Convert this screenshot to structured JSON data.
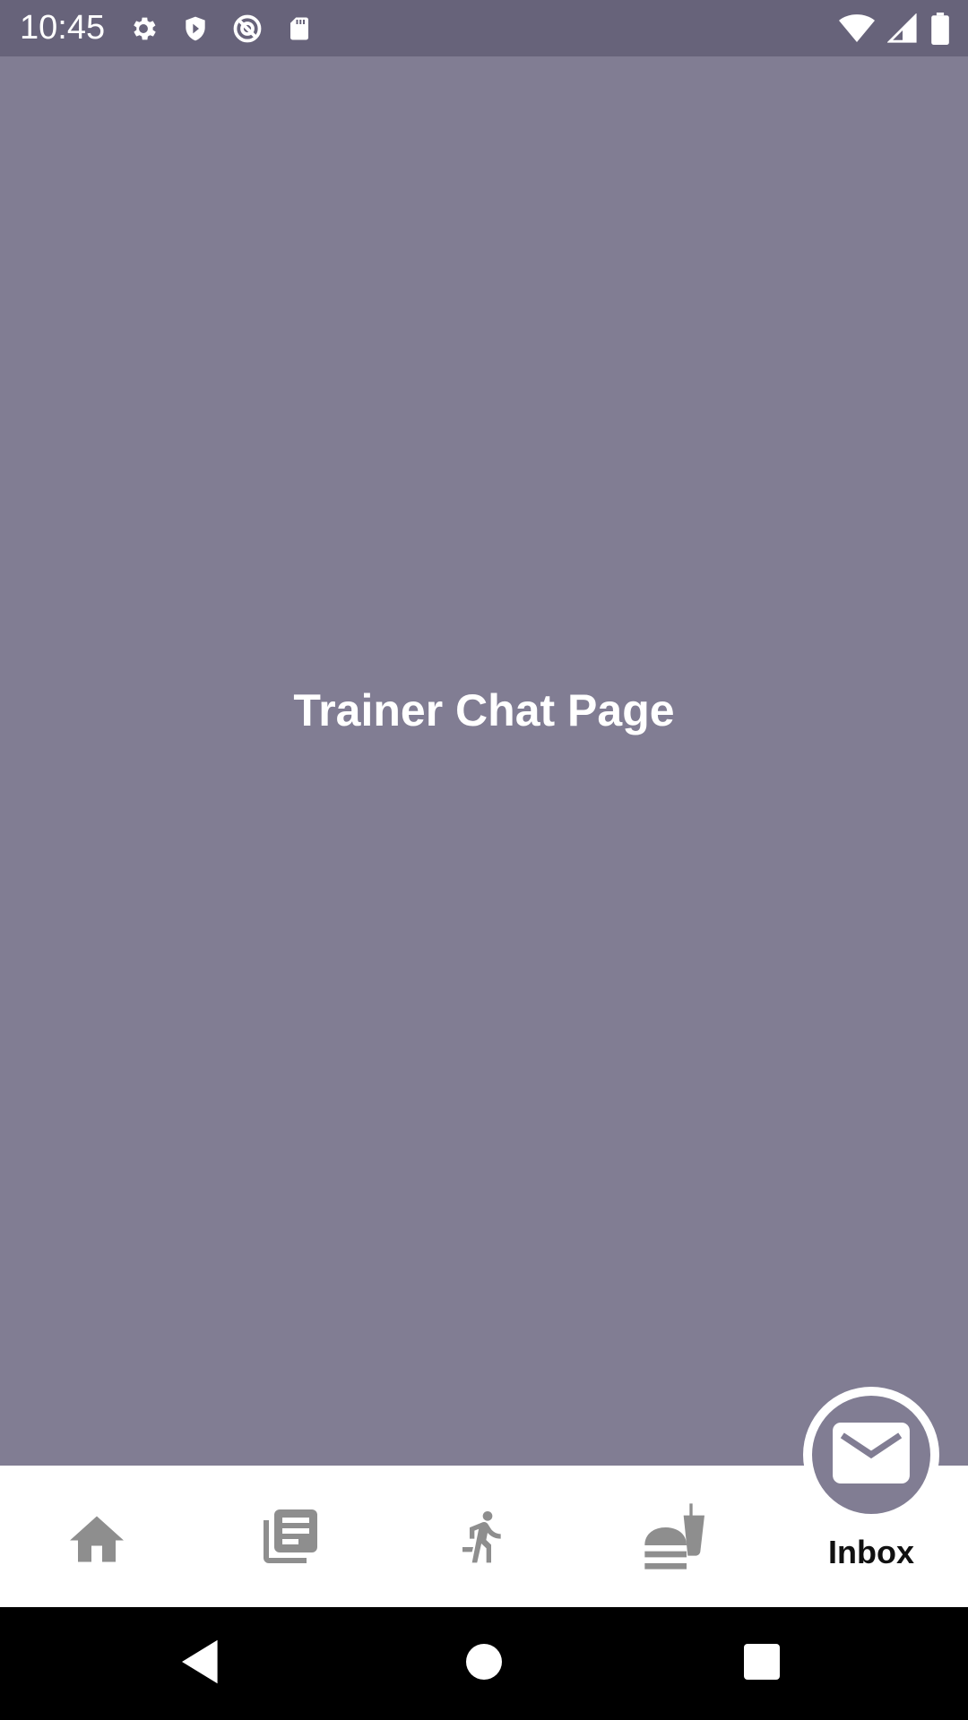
{
  "status_bar": {
    "time": "10:45",
    "left_icons": [
      "settings-icon",
      "shield-icon",
      "no-sync-icon",
      "sd-card-icon"
    ],
    "right_icons": [
      "wifi-icon",
      "signal-icon",
      "battery-icon"
    ]
  },
  "main": {
    "title": "Trainer Chat Page"
  },
  "bottom_nav": {
    "items": [
      {
        "icon": "home-icon",
        "label": ""
      },
      {
        "icon": "news-icon",
        "label": ""
      },
      {
        "icon": "activity-icon",
        "label": ""
      },
      {
        "icon": "food-icon",
        "label": ""
      },
      {
        "icon": "mail-icon",
        "label": "Inbox",
        "selected": true
      }
    ]
  },
  "system_nav": {
    "buttons": [
      "back-icon",
      "home-circle-icon",
      "recents-icon"
    ]
  },
  "colors": {
    "background": "#817d93",
    "status_bar": "#67637a",
    "nav_icon": "#8e8e8e",
    "nav_bar": "#ffffff",
    "system_bar": "#000000"
  }
}
